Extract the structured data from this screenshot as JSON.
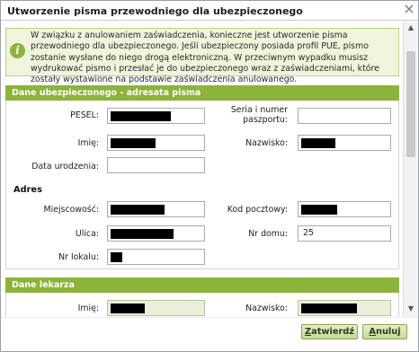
{
  "dialog": {
    "title": "Utworzenie pisma przewodniego dla ubezpieczonego",
    "close_glyph": "×"
  },
  "info": {
    "icon": "info-icon",
    "text": "W związku z anulowaniem zaświadczenia, konieczne jest utworzenie pisma przewodniego dla ubezpieczonego. Jeśli ubezpieczony posiada profil PUE, pismo zostanie wysłane do niego drogą elektroniczną. W przeciwnym wypadku musisz wydrukować pismo i przesłać je do ubezpieczonego wraz z zaświadczeniami, które zostały wystawione na podstawie zaświadczenia anulowanego."
  },
  "insured": {
    "header": "Dane ubezpieczonego - adresata pisma",
    "pesel_label": "PESEL:",
    "series_label_1": "Seria i numer",
    "series_label_2": "paszportu:",
    "first_name_label": "Imię:",
    "last_name_label": "Nazwisko:",
    "birth_date_label": "Data urodzenia:",
    "birth_date_value": "",
    "series_value": ""
  },
  "address": {
    "header": "Adres",
    "city_label": "Miejscowość:",
    "postal_label": "Kod pocztowy:",
    "street_label": "Ulica:",
    "house_label": "Nr domu:",
    "house_value": "25",
    "flat_label": "Nr lokalu:"
  },
  "doctor": {
    "header": "Dane lekarza",
    "first_name_label": "Imię:",
    "last_name_label": "Nazwisko:"
  },
  "buttons": {
    "confirm_first": "Z",
    "confirm_rest": "atwierdź",
    "cancel_first": "A",
    "cancel_rest": "nuluj"
  },
  "colors": {
    "accent": "#8db33a",
    "info_bg": "#eef5dc",
    "readonly_bg": "#e9efd9"
  }
}
